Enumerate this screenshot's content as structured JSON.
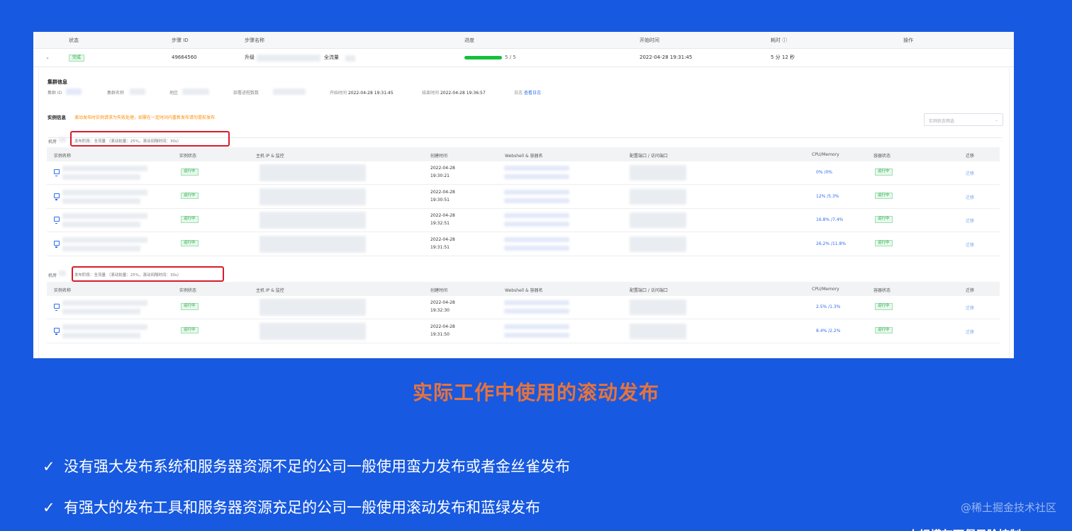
{
  "step_table": {
    "headers": [
      "状态",
      "步骤 ID",
      "步骤名称",
      "进度",
      "开始时间",
      "耗时 ⓘ",
      "操作"
    ],
    "row": {
      "status": "完成",
      "step_id": "49664560",
      "name_prefix": "升级",
      "name_suffix": "全流量",
      "progress_text": "5 / 5",
      "progress_fraction": 1.0,
      "start_time": "2022-04-28 19:31:45",
      "duration": "5 分 12 秒"
    }
  },
  "cluster_info": {
    "title": "集群信息",
    "cluster_id_label": "集群 ID",
    "cluster_name_label": "集群名称",
    "region_label": "地区",
    "process_count_label": "部署进程数数",
    "start_label": "开始时间",
    "start_value": "2022-04-28 19:31:45",
    "end_label": "结束时间",
    "end_value": "2022-04-28 19:36:57",
    "log_label": "日志",
    "log_link": "查看日志"
  },
  "instance_info": {
    "title": "实例信息",
    "warning": "滚动发布时实例请求为失败处理，如需在一定时间内重新发布请勿提前发布",
    "filter_placeholder": "实例状态筛选"
  },
  "groups": [
    {
      "label": "机房",
      "info": "发布阶段：全流量    （滚动批量：25%，滚动间隔时间：30s）",
      "headers": [
        "实例名称",
        "实例状态",
        "主机 IP & 监控",
        "创建时间",
        "Webshell & 容器名",
        "配置端口 / 访问端口",
        "CPU/Memory",
        "容器状态",
        "迁移"
      ],
      "rows": [
        {
          "status": "运行中",
          "date": "2022-04-28",
          "time": "19:30:21",
          "cpu": "0% /0%",
          "container": "运行中",
          "op": "迁移"
        },
        {
          "status": "运行中",
          "date": "2022-04-28",
          "time": "19:30:51",
          "cpu": "12% /5.3%",
          "container": "运行中",
          "op": "迁移"
        },
        {
          "status": "运行中",
          "date": "2022-04-28",
          "time": "19:32:51",
          "cpu": "16.8% /7.4%",
          "container": "运行中",
          "op": "迁移"
        },
        {
          "status": "运行中",
          "date": "2022-04-28",
          "time": "19:31:51",
          "cpu": "26.2% /11.8%",
          "container": "运行中",
          "op": "迁移"
        }
      ]
    },
    {
      "label": "机房",
      "info": "发布阶段：全流量    （滚动批量：25%，滚动间隔时间：30s）",
      "headers": [
        "实例名称",
        "实例状态",
        "主机 IP & 监控",
        "创建时间",
        "Webshell & 容器名",
        "配置端口 / 访问端口",
        "CPU/Memory",
        "容器状态",
        "迁移"
      ],
      "rows": [
        {
          "status": "运行中",
          "date": "2022-04-28",
          "time": "19:32:30",
          "cpu": "2.5% /1.3%",
          "container": "运行中",
          "op": "迁移"
        },
        {
          "status": "运行中",
          "date": "2022-04-28",
          "time": "19:31:50",
          "cpu": "8.4% /2.2%",
          "container": "运行中",
          "op": "迁移"
        }
      ]
    }
  ],
  "slide": {
    "headline": "实际工作中使用的滚动发布",
    "bullets": [
      "没有强大发布系统和服务器资源不足的公司一般使用蛮力发布或者金丝雀发布",
      "有强大的发布工具和服务器资源充足的公司一般使用滚动发布和蓝绿发布"
    ],
    "check_glyph": "✓",
    "watermark": "@稀土掘金技术社区",
    "cutoff_text": "小规模灰下保风险控制"
  },
  "colors": {
    "background": "#1759E0",
    "headline": "#E8733A",
    "highlight_box": "#d81b2c",
    "progress": "#15c03a"
  }
}
